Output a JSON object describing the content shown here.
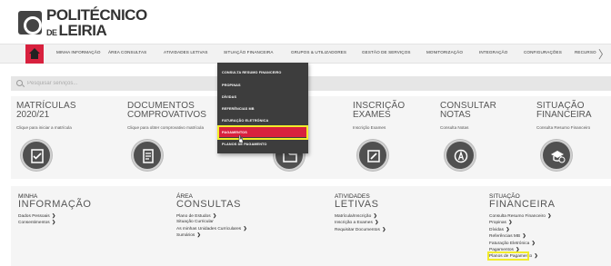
{
  "logo": {
    "line1": "POLITÉCNICO",
    "line2_prefix": "DE",
    "line2": "LEIRIA"
  },
  "nav": {
    "items": [
      "MINHA INFORMAÇÃO",
      "ÁREA CONSULTAS",
      "ATIVIDADES LETIVAS",
      "SITUAÇÃO FINANCEIRA",
      "GRUPOS & UTILIZADORES",
      "GESTÃO DE SERVIÇOS",
      "MONITORIZAÇÃO",
      "INTEGRAÇÃO",
      "CONFIGURAÇÕES",
      "RECURSO"
    ],
    "more_arrow": "〉"
  },
  "search": {
    "placeholder": "Pesquisar serviços..."
  },
  "dropdown": {
    "items": [
      "CONSULTA RESUMO FINANCEIRO",
      "PROPINAS",
      "DÍVIDAS",
      "REFERÊNCIAS MB",
      "FATURAÇÃO ELETRÓNICA",
      "PAGAMENTOS",
      "PLANOS DE PAGAMENTO"
    ],
    "active_index": 5
  },
  "tiles": [
    {
      "title": "MATRÍCULAS",
      "sub": "2020/21",
      "desc": "Clique para iniciar a matrícula",
      "icon": "checklist-icon"
    },
    {
      "title": "DOCUMENTOS",
      "sub": "COMPROVATIVOS",
      "desc": "Clique para obter comprovativo matrícula",
      "icon": "document-icon"
    },
    {
      "title": "",
      "sub": "",
      "desc": "",
      "icon": "folder-icon"
    },
    {
      "title": "INSCRIÇÃO",
      "sub": "EXAMES",
      "desc": "Inscrição Exames",
      "icon": "edit-icon"
    },
    {
      "title": "CONSULTAR",
      "sub": "NOTAS",
      "desc": "Consulta Notas",
      "icon": "grade-icon"
    },
    {
      "title": "SITUAÇÃO",
      "sub": "FINANCEIRA",
      "desc": "Consulta Resumo Financeiro",
      "icon": "money-icon"
    }
  ],
  "sections": [
    {
      "small": "MINHA",
      "big": "INFORMAÇÃO",
      "links": [
        "Dados Pessoais",
        "Consentimentos"
      ]
    },
    {
      "small": "ÁREA",
      "big": "CONSULTAS",
      "links": [
        "Plano de Estudos",
        "Situação Curricular",
        "As minhas Unidades Curriculares",
        "Sumários"
      ]
    },
    {
      "small": "ATIVIDADES",
      "big": "LETIVAS",
      "links": [
        "Matrícula/Inscrição",
        "Inscrição a Exames",
        "Requisitar Documentos"
      ]
    },
    {
      "small": "SITUAÇÃO",
      "big": "FINANCEIRA",
      "links": [
        "Consulta Resumo Financeiro",
        "Propinas",
        "Dívidas",
        "Referências MB",
        "Faturação Eletrónica",
        "Pagamentos",
        "Planos de Pagamento"
      ]
    }
  ],
  "chevron": "❯",
  "colors": {
    "accent": "#d8213e",
    "highlight": "#f2ec2a",
    "dropdown_bg": "#3d3d3d"
  }
}
